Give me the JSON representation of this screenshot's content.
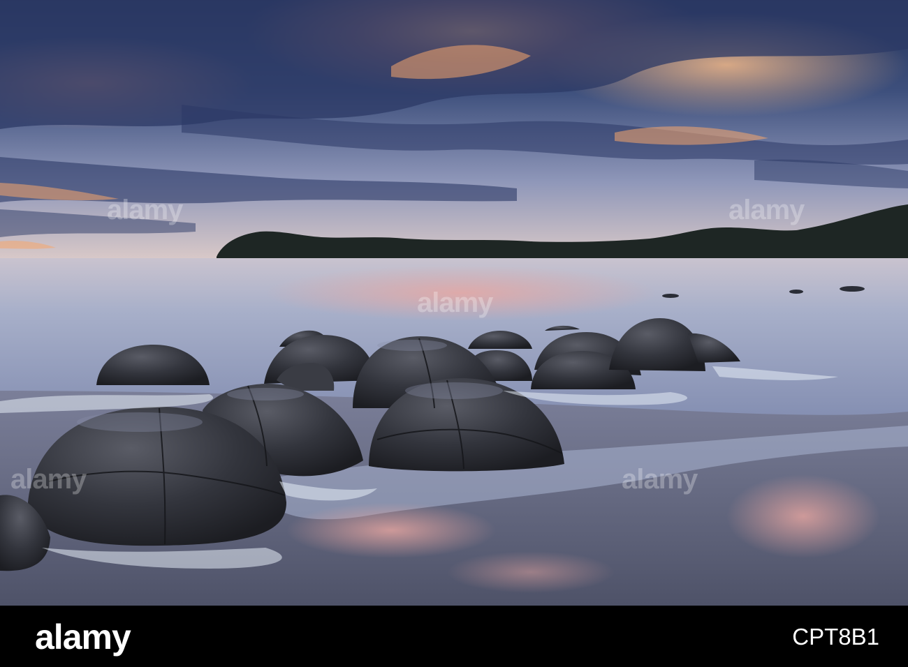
{
  "photo": {
    "watermark": "alamy",
    "colors": {
      "sky_top": "#2b3a63",
      "sky_glow": "#f2a56b",
      "sea": "#aab3cf",
      "sand": "#6f6f86",
      "boulder": "#2a2c33",
      "headland": "#1f2523"
    }
  },
  "footer": {
    "logo": "alamy",
    "image_id": "CPT8B1",
    "background": "#000000"
  }
}
